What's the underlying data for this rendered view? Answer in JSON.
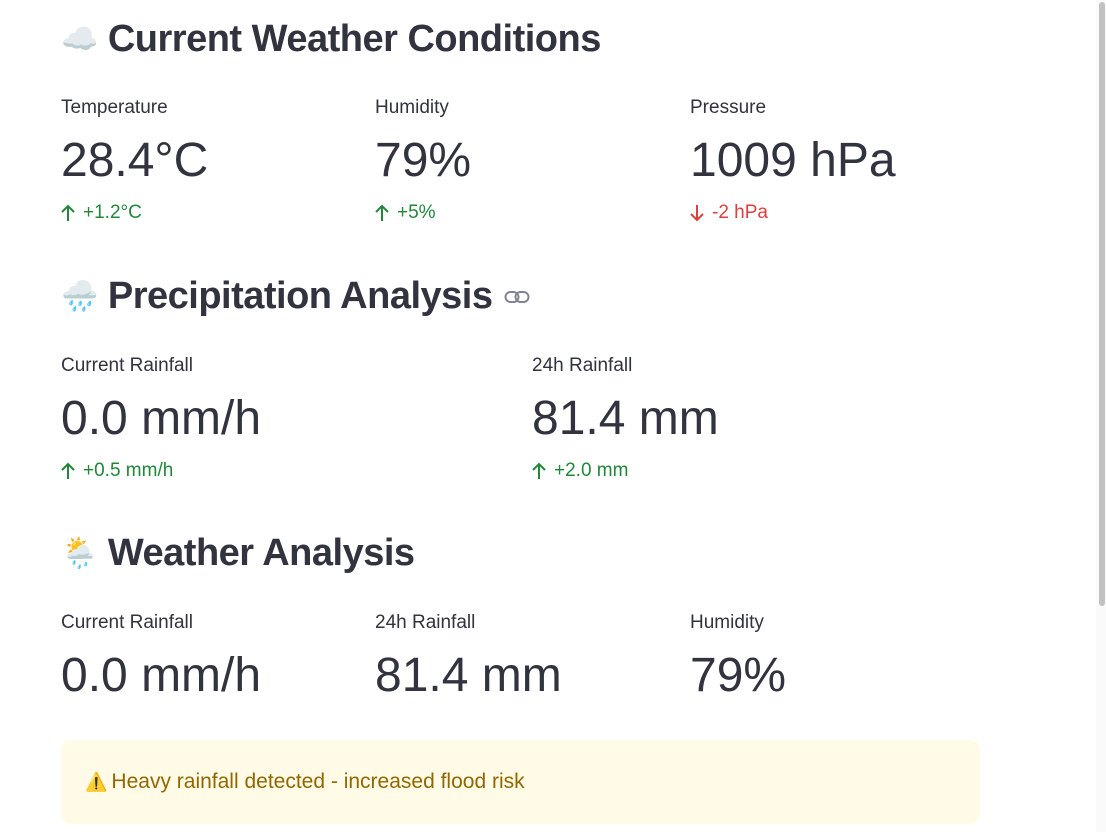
{
  "current": {
    "emoji": "☁️",
    "title": "Current Weather Conditions",
    "metrics": [
      {
        "label": "Temperature",
        "value": "28.4°C",
        "delta": "+1.2°C",
        "direction": "up"
      },
      {
        "label": "Humidity",
        "value": "79%",
        "delta": "+5%",
        "direction": "up"
      },
      {
        "label": "Pressure",
        "value": "1009 hPa",
        "delta": "-2 hPa",
        "direction": "down"
      }
    ]
  },
  "precipitation": {
    "emoji": "🌧️",
    "title": "Precipitation Analysis",
    "link_icon": "link-icon",
    "metrics": [
      {
        "label": "Current Rainfall",
        "value": "0.0 mm/h",
        "delta": "+0.5 mm/h",
        "direction": "up"
      },
      {
        "label": "24h Rainfall",
        "value": "81.4 mm",
        "delta": "+2.0 mm",
        "direction": "up"
      }
    ]
  },
  "analysis": {
    "emoji": "🌦️",
    "title": "Weather Analysis",
    "metrics": [
      {
        "label": "Current Rainfall",
        "value": "0.0 mm/h"
      },
      {
        "label": "24h Rainfall",
        "value": "81.4 mm"
      },
      {
        "label": "Humidity",
        "value": "79%"
      }
    ]
  },
  "alert": {
    "icon": "⚠️",
    "text": "Heavy rainfall detected - increased flood risk"
  },
  "colors": {
    "text": "#31333f",
    "delta_up": "#21873a",
    "delta_down": "#e03e3e",
    "alert_bg": "#fffbe6",
    "alert_text": "#916800"
  }
}
